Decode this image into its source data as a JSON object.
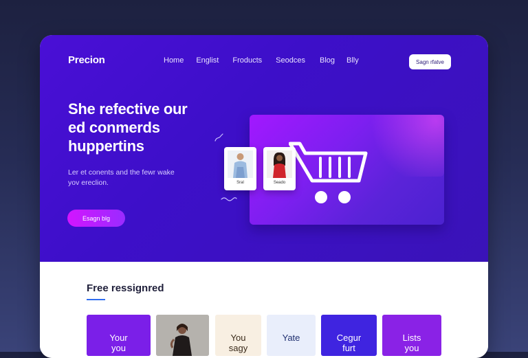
{
  "brand": "Precion",
  "nav": {
    "items": [
      "Home",
      "Englist",
      "Froducts",
      "Seodces",
      "Blog",
      "Blly"
    ],
    "signup_label": "Sagn rfatve"
  },
  "hero": {
    "headline_lines": [
      "She refective our",
      "ed conmerds",
      "huppertins"
    ],
    "subtext_lines": [
      "Ler et conents and the fewr wake",
      "yov ereclion."
    ],
    "cta_label": "Esagn blg",
    "product_cards": [
      {
        "label": "Sral"
      },
      {
        "label": "Seado"
      }
    ]
  },
  "section": {
    "title": "Free ressignred",
    "tiles": [
      {
        "label": "Your\nyou",
        "bg": "#7b1fe8",
        "color": "#ffffff"
      },
      {
        "label": "",
        "bg": "#b7b4ae",
        "color": "#ffffff"
      },
      {
        "label": "You\nsagy",
        "bg": "#f8efe2",
        "color": "#3a2a1a"
      },
      {
        "label": "Yate",
        "bg": "#e9eefb",
        "color": "#203070"
      },
      {
        "label": "Cegur\nfurt",
        "bg": "#3f24e0",
        "color": "#ffffff"
      },
      {
        "label": "Lists\nyou",
        "bg": "#8a22e6",
        "color": "#ffffff"
      }
    ]
  },
  "colors": {
    "hero_bg": "#4312cf",
    "accent": "#d315ff",
    "underline": "#2f6df0"
  }
}
